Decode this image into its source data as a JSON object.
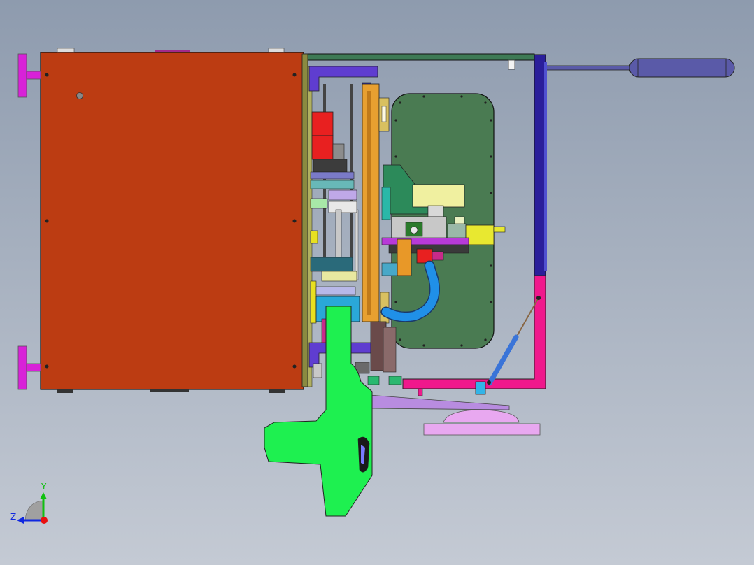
{
  "viewport": {
    "background_top": "#8e9bae",
    "background_bottom": "#c4cad4"
  },
  "model": {
    "colors": {
      "cabinet": "#bc3c12",
      "window_panel": "#4a7b52",
      "green_bracket": "#1ef050",
      "pink_frame": "#f0188c",
      "purple_handle": "#5a5aa8",
      "magenta_knob": "#d822d8",
      "lavender_base": "#e8a8f0",
      "orange_rail": "#e8a030",
      "blue_tube": "#2090e8",
      "red_motor": "#e82020",
      "navy_frame": "#2a1e9a"
    }
  },
  "triad": {
    "y_label": "Y",
    "z_label": "Z",
    "y_axis_color": "#10c010",
    "z_axis_color": "#1028e0",
    "origin_color": "#e81010"
  }
}
